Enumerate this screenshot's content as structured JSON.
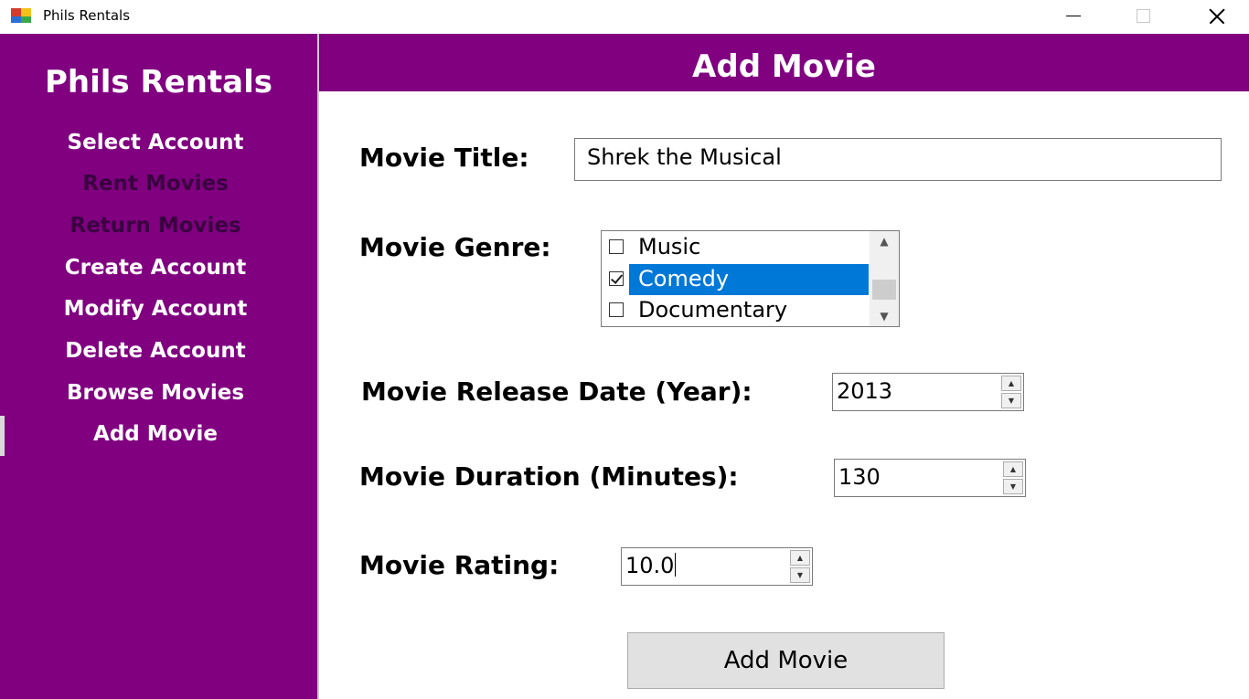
{
  "window": {
    "title": "Phils Rentals"
  },
  "sidebar": {
    "app_title": "Phils Rentals",
    "items": [
      {
        "label": "Select Account"
      },
      {
        "label": "Rent Movies"
      },
      {
        "label": "Return Movies"
      },
      {
        "label": "Create Account"
      },
      {
        "label": "Modify Account"
      },
      {
        "label": "Delete Account"
      },
      {
        "label": "Browse Movies"
      },
      {
        "label": "Add Movie"
      }
    ],
    "active_item": "Add Movie",
    "disabled_items": [
      "Rent Movies",
      "Return Movies"
    ]
  },
  "header": {
    "title": "Add Movie"
  },
  "form": {
    "title_label": "Movie Title:",
    "title_value": "Shrek the Musical",
    "genre_label": "Movie Genre:",
    "genres": [
      {
        "label": "Music",
        "checked": false
      },
      {
        "label": "Comedy",
        "checked": true,
        "selected": true
      },
      {
        "label": "Documentary",
        "checked": false
      }
    ],
    "release_label": "Movie Release Date (Year):",
    "release_value": "2013",
    "duration_label": "Movie Duration (Minutes):",
    "duration_value": "130",
    "rating_label": "Movie Rating:",
    "rating_value": "10.0",
    "submit_label": "Add Movie"
  },
  "colors": {
    "accent": "#800080",
    "selection": "#0078d7"
  }
}
